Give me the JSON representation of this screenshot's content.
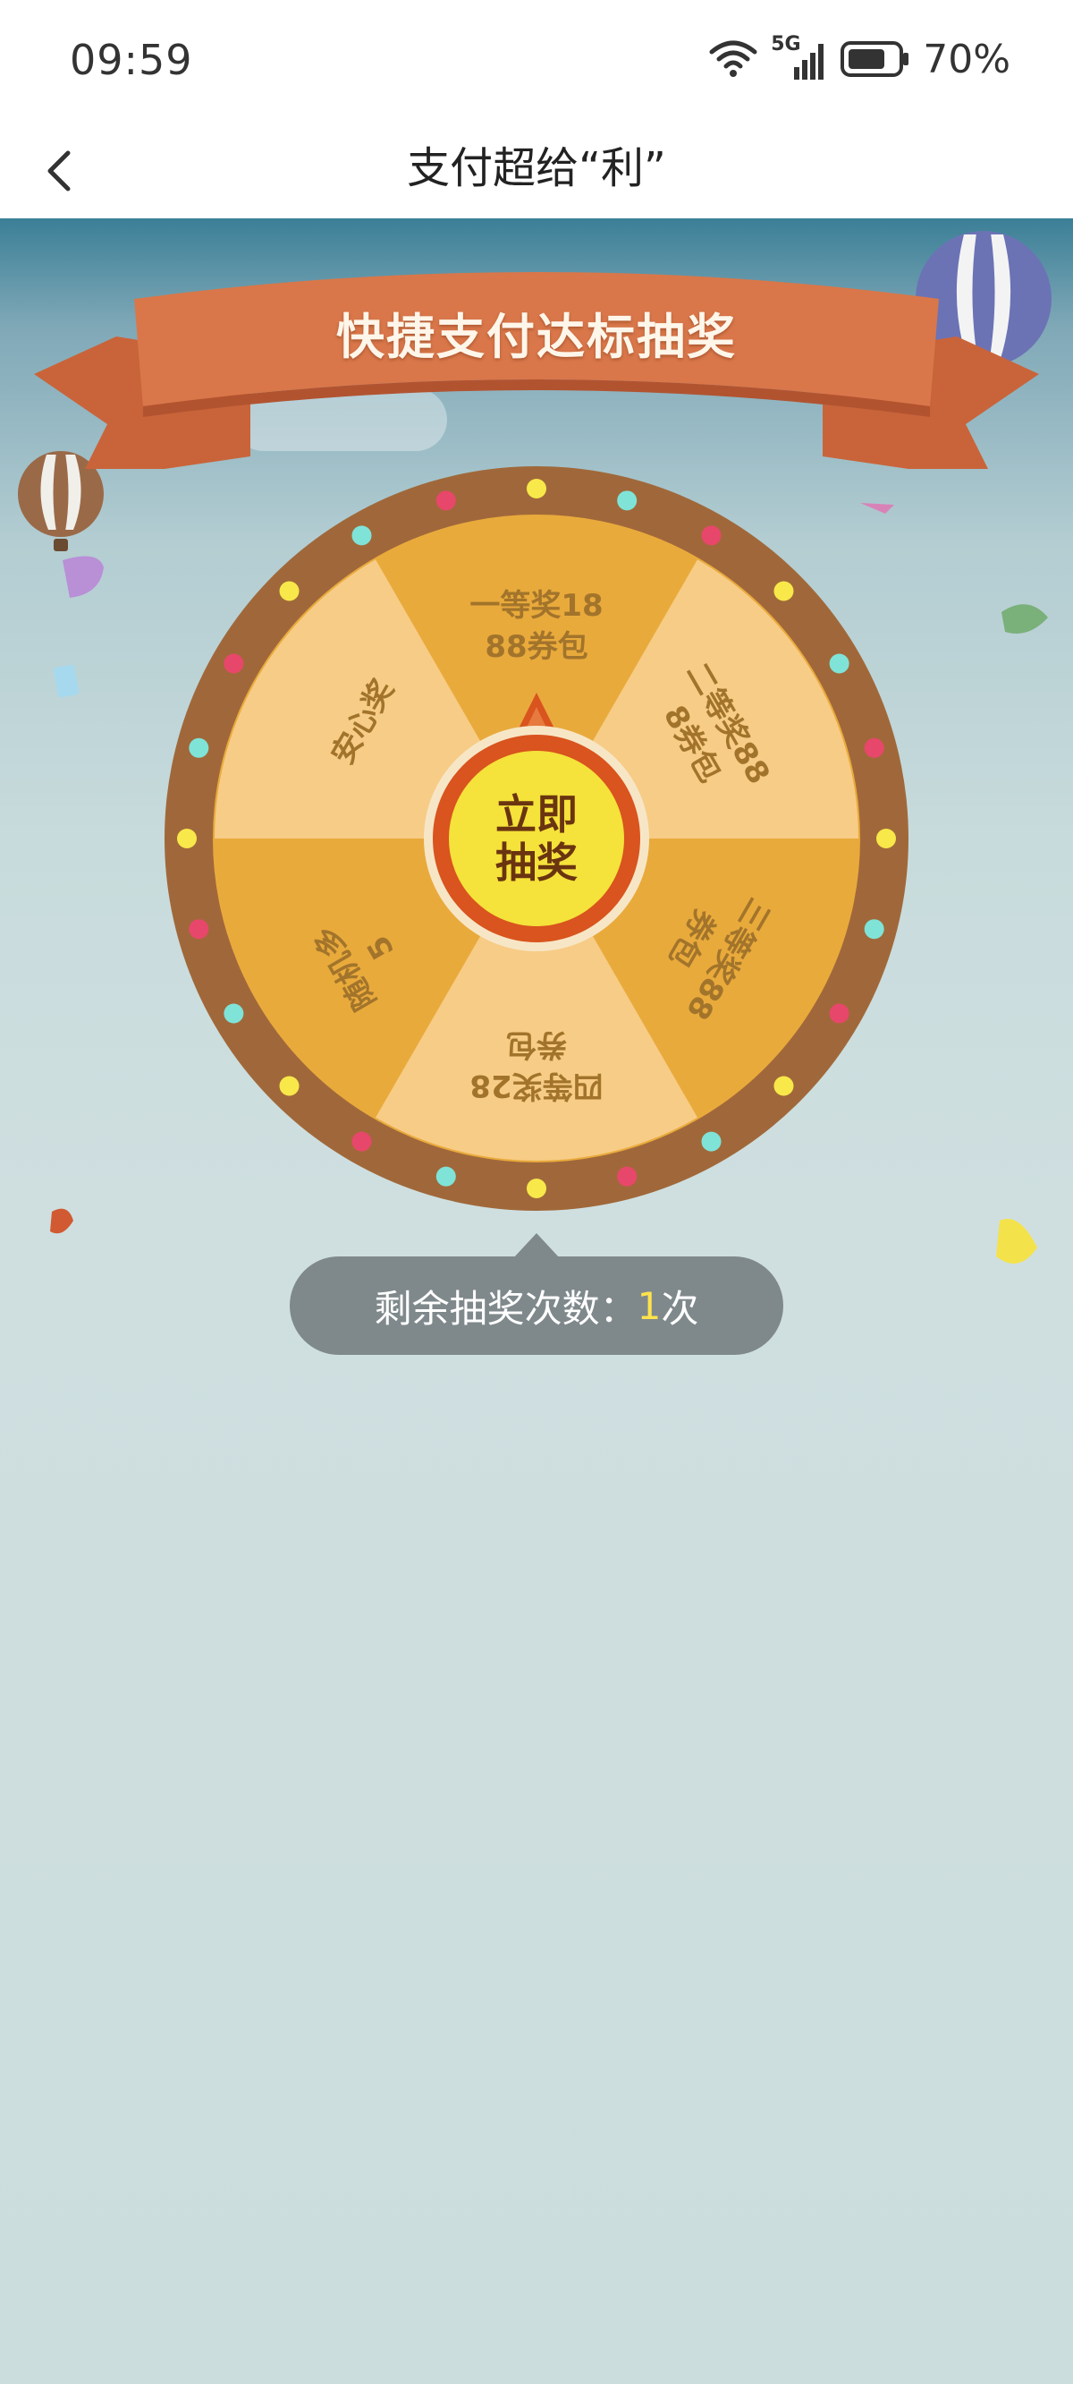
{
  "status_bar": {
    "time": "09:59",
    "network": "5G",
    "battery": "70%",
    "icons": [
      "wifi-icon",
      "signal-icon",
      "battery-icon"
    ]
  },
  "nav": {
    "back_icon": "chevron-left-icon",
    "title": "支付超给“利”"
  },
  "banner": {
    "title": "快捷支付达标抽奖"
  },
  "wheel": {
    "prizes": [
      {
        "line1": "一等奖18",
        "line2": "88券包"
      },
      {
        "line1": "二等奖88",
        "line2": "8券包"
      },
      {
        "line1": "三等奖88",
        "line2": "券包"
      },
      {
        "line1": "四等奖28",
        "line2": "券包"
      },
      {
        "line1": "随机多",
        "line2": "5"
      },
      {
        "line1": "安心奖",
        "line2": ""
      }
    ],
    "button_line1": "立即",
    "button_line2": "抽奖"
  },
  "draws": {
    "label": "剩余抽奖次数：",
    "count": "1",
    "unit": "次"
  },
  "colors": {
    "ribbon": "#d9774a",
    "wheel_rim": "#a0683a",
    "slice_dark": "#e9aa3c",
    "slice_light": "#f7cc86",
    "button": "#f5e23a",
    "pointer": "#d9541e",
    "pill": "#7f898c"
  }
}
